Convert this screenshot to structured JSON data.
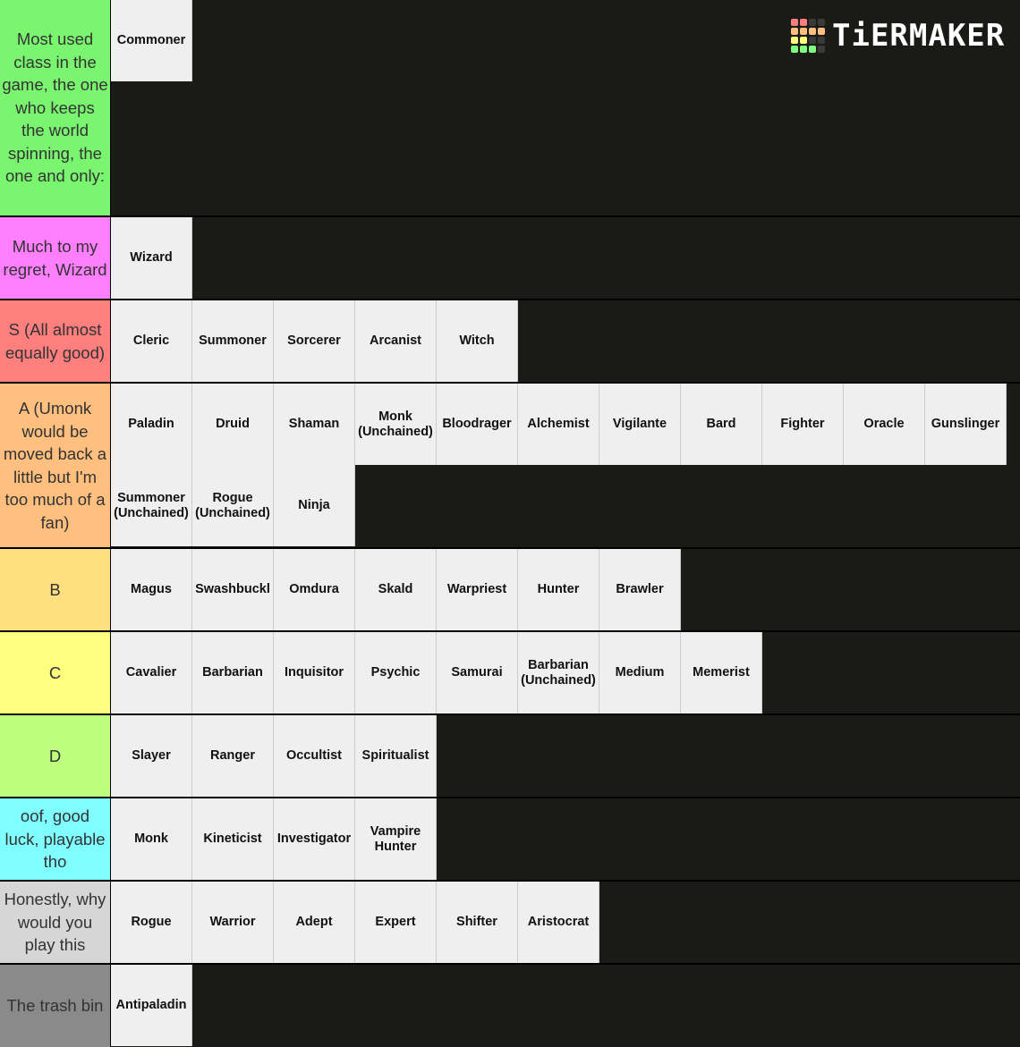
{
  "logo": {
    "text": "TiERMAKER",
    "grid_colors": [
      "#ff7f7f",
      "#ff7f7f",
      "#3a3a3a",
      "#3a3a3a",
      "#ffbf7f",
      "#ffbf7f",
      "#ffbf7f",
      "#ffbf7f",
      "#ffff7f",
      "#ffff7f",
      "#3a3a3a",
      "#3a3a3a",
      "#7fff7f",
      "#7fff7f",
      "#7fff7f",
      "#3a3a3a"
    ]
  },
  "tiers": [
    {
      "label": "Most used class in the game, the one who keeps the world spinning, the one and only:",
      "color": "#7af56f",
      "items": [
        "Commoner"
      ]
    },
    {
      "label": "Much to my regret, Wizard",
      "color": "#ff7fff",
      "items": [
        "Wizard"
      ]
    },
    {
      "label": "S (All almost equally good)",
      "color": "#ff7f7f",
      "items": [
        "Cleric",
        "Summoner",
        "Sorcerer",
        "Arcanist",
        "Witch"
      ]
    },
    {
      "label": "A (Umonk would be moved back a little but I'm too much of a fan)",
      "color": "#ffbf7f",
      "items": [
        "Paladin",
        "Druid",
        "Shaman",
        "Monk\n(Unchained)",
        "Bloodrager",
        "Alchemist",
        "Vigilante",
        "Bard",
        "Fighter",
        "Oracle",
        "Gunslinger",
        "Summoner\n(Unchained)",
        "Rogue\n(Unchained)",
        "Ninja"
      ]
    },
    {
      "label": "B",
      "color": "#ffdf7f",
      "items": [
        "Magus",
        "Swashbuckl",
        "Omdura",
        "Skald",
        "Warpriest",
        "Hunter",
        "Brawler"
      ]
    },
    {
      "label": "C",
      "color": "#ffff7f",
      "items": [
        "Cavalier",
        "Barbarian",
        "Inquisitor",
        "Psychic",
        "Samurai",
        "Barbarian\n(Unchained)",
        "Medium",
        "Memerist"
      ]
    },
    {
      "label": "D",
      "color": "#bfff7f",
      "items": [
        "Slayer",
        "Ranger",
        "Occultist",
        "Spiritualist"
      ]
    },
    {
      "label": "oof, good luck, playable tho",
      "color": "#7fffff",
      "items": [
        "Monk",
        "Kineticist",
        "Investigator",
        "Vampire\nHunter"
      ]
    },
    {
      "label": "Honestly, why would you play this",
      "color": "#d6d6d6",
      "items": [
        "Rogue",
        "Warrior",
        "Adept",
        "Expert",
        "Shifter",
        "Aristocrat"
      ]
    },
    {
      "label": "The trash bin",
      "color": "#8a8a8a",
      "items": [
        "Antipaladin"
      ]
    }
  ]
}
